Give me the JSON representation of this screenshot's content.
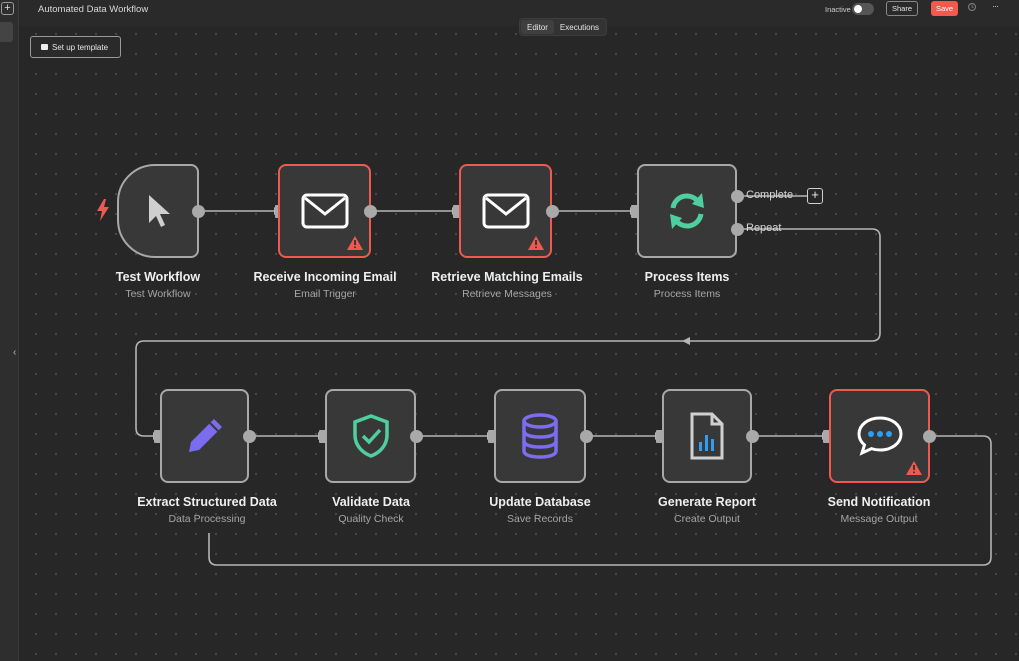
{
  "window": {
    "title": "Automated Data Workflow"
  },
  "rail": {
    "add_label": "+"
  },
  "tabs": [
    {
      "label": "Editor",
      "active": true
    },
    {
      "label": "Executions",
      "active": false
    }
  ],
  "header": {
    "status_label": "Inactive",
    "active": false,
    "share_label": "Share",
    "save_label": "Save",
    "more_label": "···"
  },
  "toolbar": {
    "setup_template_label": "Set up template"
  },
  "colors": {
    "accent": "#f05a4f",
    "error_border": "#ee5a50",
    "node_border": "#a8a8a8",
    "canvas": "#272727",
    "green": "#4fcfa0",
    "purple": "#7c6cf0",
    "blue": "#2f9ef0"
  },
  "nodes": [
    {
      "id": "trigger",
      "name": "Test Workflow",
      "subtitle": "Test Workflow",
      "icon": "cursor-icon",
      "error": false
    },
    {
      "id": "email-trigger",
      "name": "Receive Incoming Email",
      "subtitle": "Email Trigger",
      "icon": "mail-icon",
      "error": true
    },
    {
      "id": "retrieve",
      "name": "Retrieve Matching Emails",
      "subtitle": "Retrieve Messages",
      "icon": "mail-icon",
      "error": true
    },
    {
      "id": "process",
      "name": "Process Items",
      "subtitle": "Process Items",
      "icon": "loop-icon",
      "error": false
    },
    {
      "id": "extract",
      "name": "Extract Structured Data",
      "subtitle": "Data Processing",
      "icon": "pencil-icon",
      "error": false
    },
    {
      "id": "validate",
      "name": "Validate Data",
      "subtitle": "Quality Check",
      "icon": "shield-check-icon",
      "error": false
    },
    {
      "id": "update-db",
      "name": "Update Database",
      "subtitle": "Save Records",
      "icon": "database-icon",
      "error": false
    },
    {
      "id": "report",
      "name": "Generate Report",
      "subtitle": "Create Output",
      "icon": "report-icon",
      "error": false
    },
    {
      "id": "notify",
      "name": "Send Notification",
      "subtitle": "Message Output",
      "icon": "chat-bubble-icon",
      "error": true
    }
  ],
  "loop_outputs": {
    "complete_label": "Complete",
    "repeat_label": "Repeat",
    "add_label": "+"
  },
  "collapse_icon_label": "‹"
}
